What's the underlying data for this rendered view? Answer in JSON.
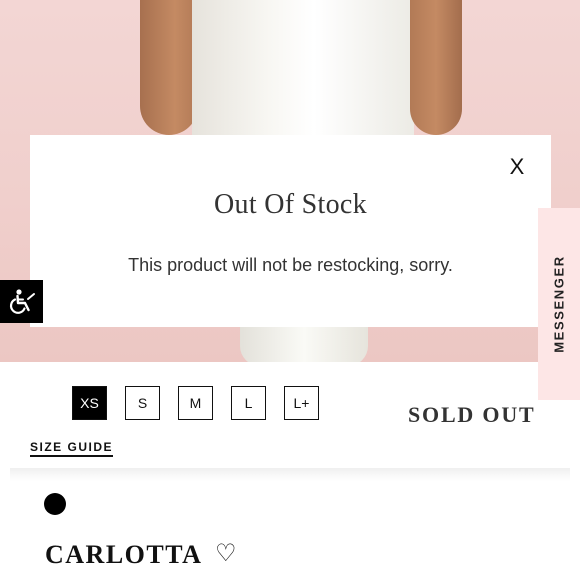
{
  "modal": {
    "close_label": "X",
    "title": "Out Of Stock",
    "message": "This product will not be restocking, sorry."
  },
  "messenger": {
    "label": "MESSENGER"
  },
  "sizes": [
    {
      "label": "XS",
      "selected": true
    },
    {
      "label": "S",
      "selected": false
    },
    {
      "label": "M",
      "selected": false
    },
    {
      "label": "L",
      "selected": false
    },
    {
      "label": "L+",
      "selected": false
    }
  ],
  "status": {
    "label": "SOLD OUT"
  },
  "size_guide": {
    "label": "SIZE GUIDE"
  },
  "colors": {
    "swatch": "#000000",
    "messenger_bg": "#fde6e6",
    "hero_bg": "#f0cfcc"
  },
  "product": {
    "name": "CARLOTTA",
    "favorite_icon": "heart-outline-icon"
  },
  "icons": {
    "accessibility": "accessibility-icon",
    "close": "close-icon"
  }
}
